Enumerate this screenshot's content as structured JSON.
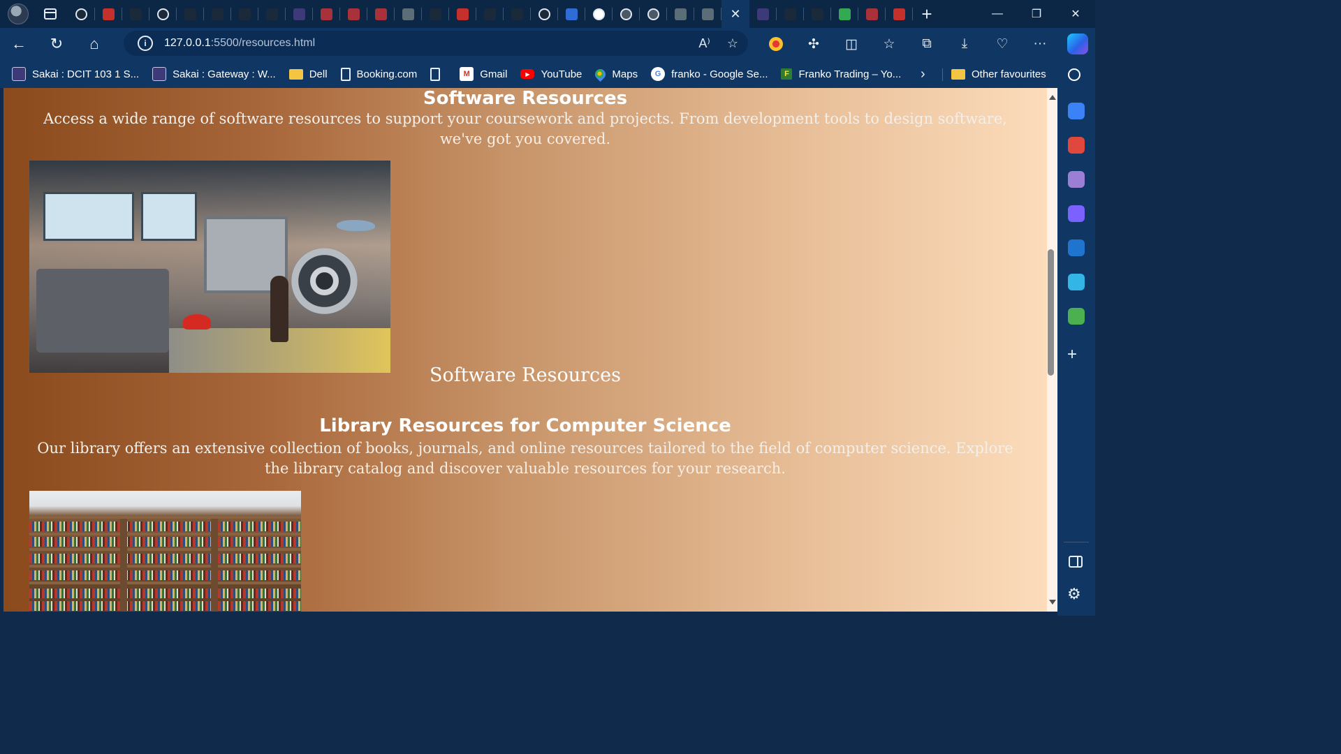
{
  "browser": {
    "url_host": "127.0.0.1",
    "url_path": ":5500/resources.html",
    "tabs": [
      {
        "icon": "github-icon",
        "color": "#1b2a3b"
      },
      {
        "icon": "youtube-icon",
        "color": "#c4302b"
      },
      {
        "icon": "search-icon",
        "color": "#1b2a3b"
      },
      {
        "icon": "github-icon",
        "color": "#1b2a3b"
      },
      {
        "icon": "search-icon",
        "color": "#1b2a3b"
      },
      {
        "icon": "search-icon",
        "color": "#1b2a3b"
      },
      {
        "icon": "blank-icon",
        "color": "#1b2a3b"
      },
      {
        "icon": "search-icon",
        "color": "#1b2a3b"
      },
      {
        "icon": "sakai-icon",
        "color": "#3d3a7a"
      },
      {
        "icon": "video-icon",
        "color": "#a9313a"
      },
      {
        "icon": "pdf-icon",
        "color": "#a9313a"
      },
      {
        "icon": "pdf-icon",
        "color": "#a9313a"
      },
      {
        "icon": "chatgpt-icon",
        "color": "#5b6e78"
      },
      {
        "icon": "ellipsis-icon",
        "color": "#1b2a3b"
      },
      {
        "icon": "youtube-icon",
        "color": "#c4302b"
      },
      {
        "icon": "page-icon",
        "color": "#1b2a3b"
      },
      {
        "icon": "flag-icon",
        "color": "#1b2a3b"
      },
      {
        "icon": "github-icon",
        "color": "#1b2a3b"
      },
      {
        "icon": "document-icon",
        "color": "#2f6cd6"
      },
      {
        "icon": "github-icon",
        "color": "#ffffff"
      },
      {
        "icon": "github-icon",
        "color": "#4a5868"
      },
      {
        "icon": "github-icon",
        "color": "#4a5868"
      },
      {
        "icon": "chatgpt-icon",
        "color": "#5b6e78"
      },
      {
        "icon": "chatgpt-icon",
        "color": "#5b6e78"
      },
      {
        "icon": "close-icon",
        "color": "#103763",
        "active": true
      },
      {
        "icon": "sakai-icon",
        "color": "#3d3a7a"
      },
      {
        "icon": "ellipsis-icon",
        "color": "#1b2a3b"
      },
      {
        "icon": "search-icon",
        "color": "#1b2a3b"
      },
      {
        "icon": "maps-icon",
        "color": "#34a853"
      },
      {
        "icon": "pdf-icon",
        "color": "#a9313a"
      },
      {
        "icon": "youtube-icon",
        "color": "#c4302b"
      }
    ]
  },
  "favourites": {
    "items": [
      {
        "label": "Sakai : DCIT 103 1 S...",
        "icon": "sakai-icon"
      },
      {
        "label": "Sakai : Gateway : W...",
        "icon": "sakai-icon"
      },
      {
        "label": "Dell",
        "icon": "folder-icon"
      },
      {
        "label": "Booking.com",
        "icon": "page-icon"
      },
      {
        "label": "",
        "icon": "page-icon"
      },
      {
        "label": "Gmail",
        "icon": "gmail-icon"
      },
      {
        "label": "YouTube",
        "icon": "youtube-icon"
      },
      {
        "label": "Maps",
        "icon": "maps-icon"
      },
      {
        "label": "franko - Google Se...",
        "icon": "google-icon"
      },
      {
        "label": "Franko Trading – Yo...",
        "icon": "franko-icon"
      }
    ],
    "other": "Other favourites"
  },
  "page": {
    "section1": {
      "title": "Software Resources",
      "text": "Access a wide range of software resources to support your coursework and projects. From development tools to design software, we've got you covered.",
      "caption": "Software Resources"
    },
    "section2": {
      "title": "Library Resources for Computer Science",
      "text": "Our library offers an extensive collection of books, journals, and online resources tailored to the field of computer science. Explore the library catalog and discover valuable resources for your research."
    }
  },
  "sidebar": {
    "items": [
      {
        "icon": "search-icon",
        "color": "#ffffff"
      },
      {
        "icon": "shopping-tag-icon",
        "color": "#3b82f6"
      },
      {
        "icon": "toolbox-icon",
        "color": "#e0483e"
      },
      {
        "icon": "games-icon",
        "color": "#9b7fd4"
      },
      {
        "icon": "copilot-icon",
        "color": "#7b61ff"
      },
      {
        "icon": "outlook-icon",
        "color": "#1f74d0"
      },
      {
        "icon": "send-icon",
        "color": "#33b5e5"
      },
      {
        "icon": "tree-icon",
        "color": "#4caf50"
      }
    ]
  }
}
